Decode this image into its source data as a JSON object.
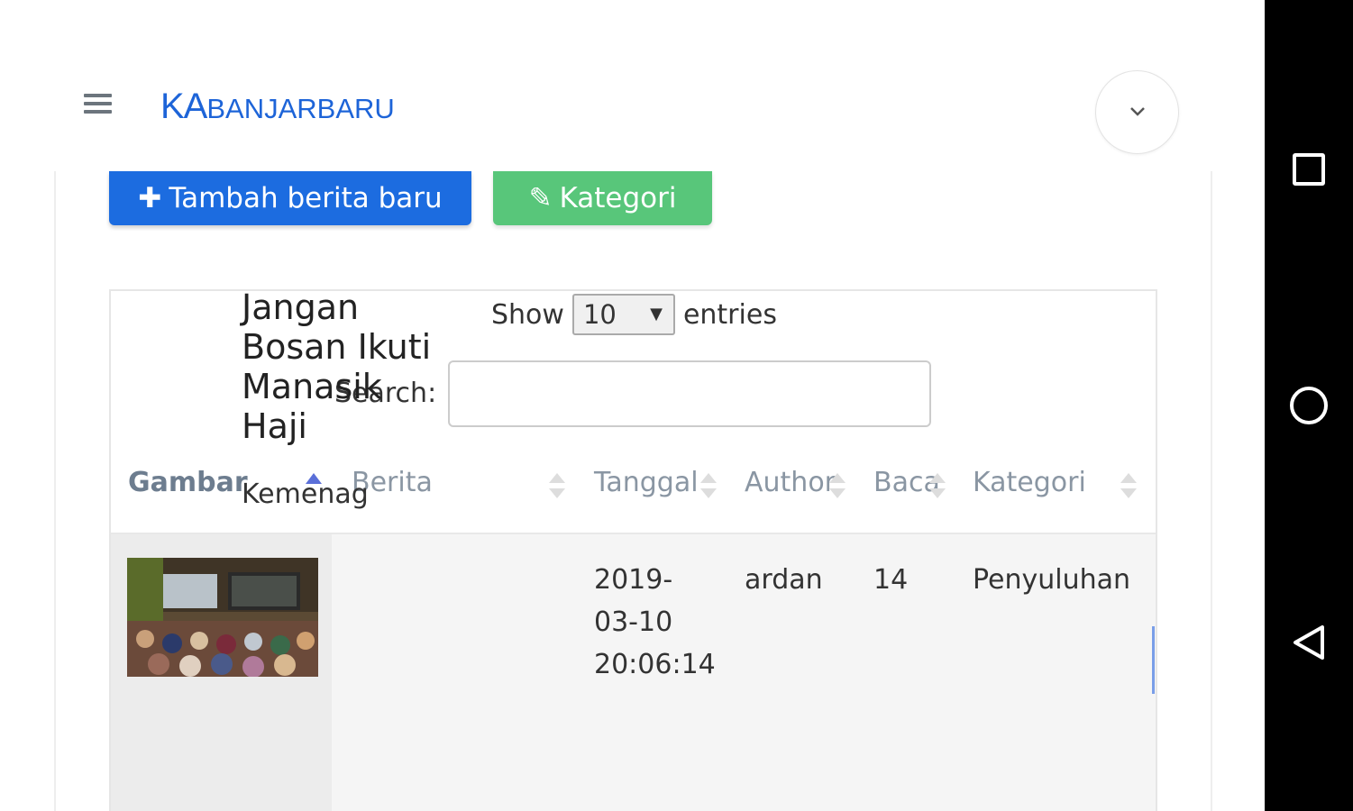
{
  "header": {
    "brand_ka": "KA",
    "brand_rest": "BANJARBARU"
  },
  "actions": {
    "add_label": "Tambah berita baru",
    "category_label": "Kategori"
  },
  "table_controls": {
    "show_label": "Show",
    "entries_value": "10",
    "entries_label": "entries",
    "search_label": "Search:",
    "search_value": ""
  },
  "columns": [
    "Gambar",
    "Berita",
    "Tanggal",
    "Author",
    "Baca",
    "Kategori"
  ],
  "rows": [
    {
      "title": "Jangan Bosan Ikuti Manasik Haji",
      "subtitle": "Kemenag",
      "date_line1": "2019-",
      "date_line2": "03-10",
      "date_line3": "20:06:14",
      "author": "ardan",
      "reads": "14",
      "category": "Penyuluhan"
    }
  ]
}
